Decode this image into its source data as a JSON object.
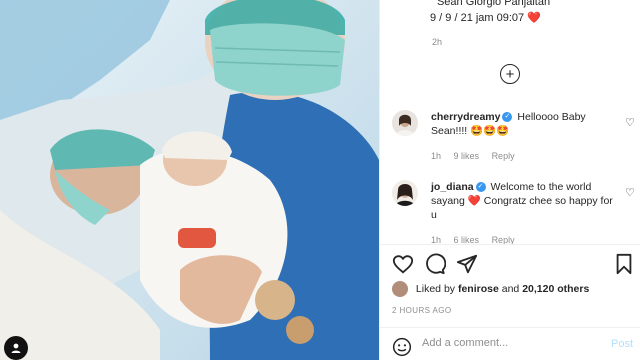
{
  "caption": {
    "line1": "\" Sean Giorgio Panjaitan \"",
    "line2": "9 / 9 / 21 jam 09:07",
    "line2_emoji": "❤️",
    "time": "2h"
  },
  "comments": [
    {
      "username": "cherrydreamy",
      "text": "Helloooo Baby Sean!!!!",
      "emojis": "🤩🤩🤩",
      "time": "1h",
      "likes": "9 likes",
      "reply": "Reply"
    },
    {
      "username": "jo_diana",
      "text": "Welcome to the world sayang",
      "emoji_mid": "❤️",
      "text2": "Congratz chee so happy for u",
      "time": "1h",
      "likes": "6 likes",
      "reply": "Reply"
    }
  ],
  "likes": {
    "prefix": "Liked by",
    "user": "fenirose",
    "middle": "and",
    "count": "20,120 others"
  },
  "posted_ago": "2 HOURS AGO",
  "add_comment": {
    "placeholder": "Add a comment...",
    "post_label": "Post"
  },
  "icons": {
    "heart": "heart-icon",
    "comment": "comment-icon",
    "share": "share-icon",
    "save": "bookmark-icon",
    "emoji": "smiley-icon",
    "load_more": "plus-circle-icon"
  },
  "colors": {
    "verified": "#3897f0",
    "link_blue_disabled": "#b2dffc",
    "muted": "#8e8e8e",
    "text": "#262626"
  }
}
